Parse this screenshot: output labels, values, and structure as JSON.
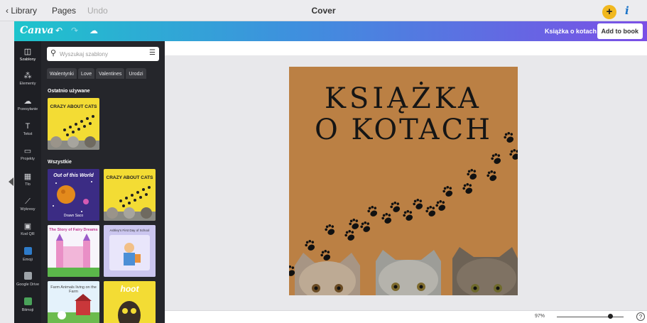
{
  "topbar": {
    "back_label": "‹ Library",
    "pages_label": "Pages",
    "undo_label": "Undo",
    "title": "Cover",
    "plus_icon": "+",
    "info_icon": "i"
  },
  "canva_bar": {
    "logo": "Canva",
    "book_label": "Książka o kotach",
    "add_button": "Add to book"
  },
  "rail": {
    "items": [
      {
        "label": "Szablony",
        "icon": "template-icon",
        "glyph": "◫"
      },
      {
        "label": "Elementy",
        "icon": "elements-icon",
        "glyph": "⁂"
      },
      {
        "label": "Przesyłanie",
        "icon": "upload-cloud-icon",
        "glyph": "☁"
      },
      {
        "label": "Tekst",
        "icon": "text-icon",
        "glyph": "T"
      },
      {
        "label": "Projekty",
        "icon": "folder-icon",
        "glyph": "▭"
      },
      {
        "label": "Tło",
        "icon": "background-icon",
        "glyph": "▦"
      },
      {
        "label": "Wykresy",
        "icon": "chart-icon",
        "glyph": "⟋"
      },
      {
        "label": "Kod QR",
        "icon": "qr-code-icon",
        "glyph": "▣"
      },
      {
        "label": "Emoji",
        "icon": "emoji-icon",
        "glyph": ""
      },
      {
        "label": "Google Drive",
        "icon": "google-drive-icon",
        "glyph": ""
      },
      {
        "label": "Bitmoji",
        "icon": "bitmoji-icon",
        "glyph": ""
      }
    ]
  },
  "panel": {
    "search_placeholder": "Wyszukaj szablony",
    "chips": [
      "Walentynki",
      "Love",
      "Valentines",
      "Urodzi"
    ],
    "recent_heading": "Ostatnio używane",
    "all_heading": "Wszystkie",
    "thumbs": {
      "cats_title": "CRAZY ABOUT CATS",
      "world_title": "Out of this World",
      "world_author": "Drawn Saco",
      "fairy_title": "The Story of Fairy Dreams",
      "ashley_title": "Ashley's First Day of School",
      "farm_title": "Farm Animals living on the Farm",
      "hoot_title": "hoot"
    }
  },
  "design": {
    "title_line1": "KSIĄŻKA",
    "title_line2": "O KOTACH",
    "background": "#bb8044"
  },
  "bottombar": {
    "zoom": "97%",
    "zoom_fraction": 0.8,
    "help": "?"
  }
}
